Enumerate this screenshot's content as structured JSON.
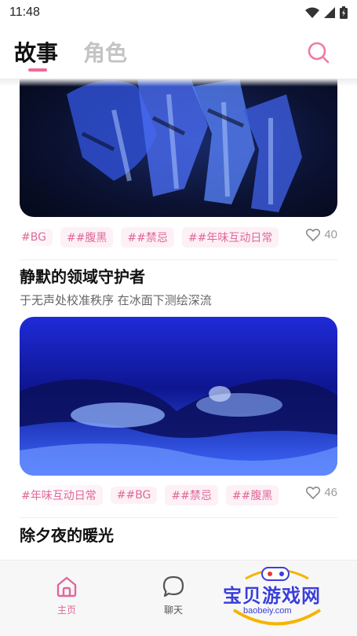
{
  "status_bar": {
    "time": "11:48"
  },
  "header": {
    "tabs": [
      {
        "label": "故事",
        "active": true
      },
      {
        "label": "角色",
        "active": false
      }
    ],
    "search_icon": "search-icon"
  },
  "feed": {
    "cards": [
      {
        "image": "hand-artwork",
        "tags": [
          "#BG",
          "##腹黑",
          "##禁忌",
          "##年味互动日常"
        ],
        "likes": "40",
        "title": "静默的领域守护者",
        "description": "于无声处校准秩序 在冰面下测绘深流"
      },
      {
        "image": "eyes-artwork",
        "tags": [
          "#年味互动日常",
          "##BG",
          "##禁忌",
          "##腹黑"
        ],
        "likes": "46",
        "title": "除夕夜的暖光"
      }
    ]
  },
  "bottom_nav": {
    "items": [
      {
        "label": "主页",
        "icon": "home-icon",
        "active": true
      },
      {
        "label": "聊天",
        "icon": "chat-icon",
        "active": false
      }
    ]
  },
  "watermark": {
    "text": "宝贝游戏网",
    "url": "baobeiy.com"
  },
  "colors": {
    "accent": "#e0689a",
    "tag_bg": "#fdf1f5",
    "inactive_tab": "#c4c4c4"
  }
}
